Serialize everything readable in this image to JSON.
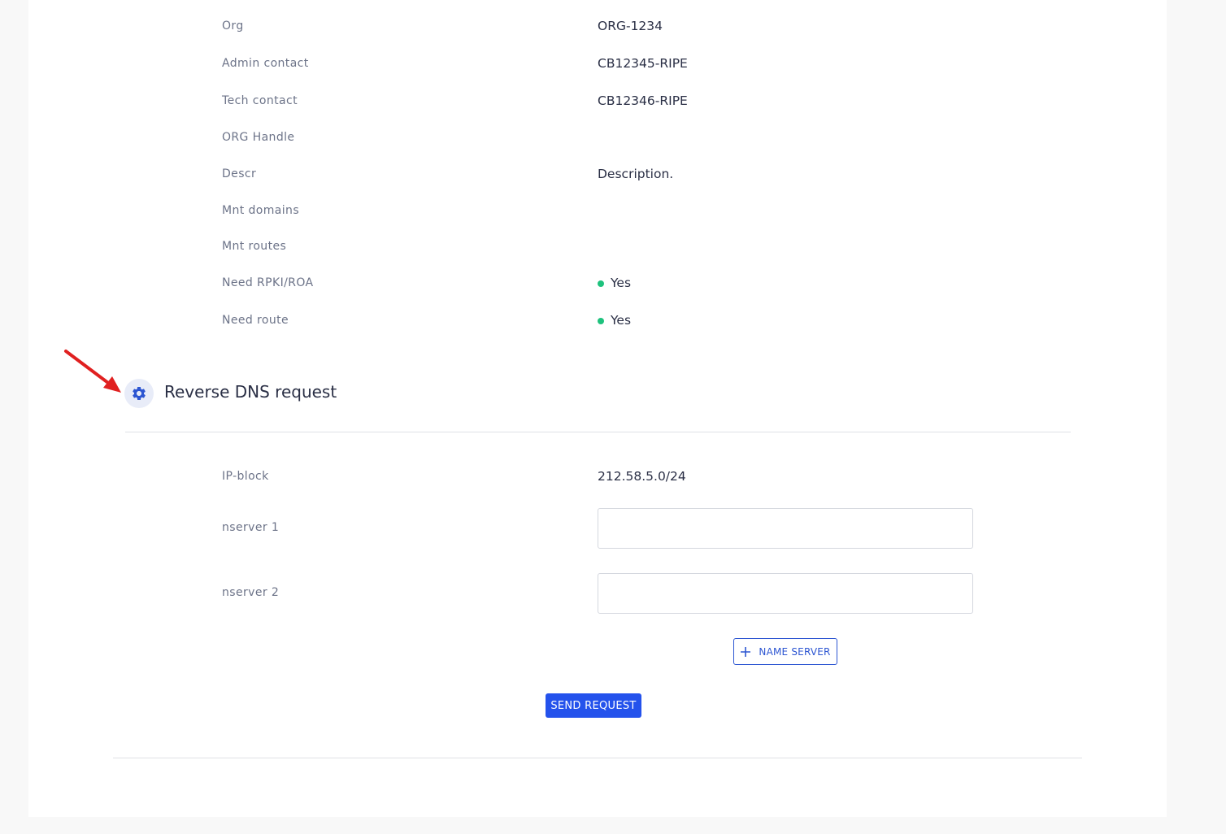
{
  "fields": {
    "org": {
      "label": "Org",
      "value": "ORG-1234"
    },
    "admin_contact": {
      "label": "Admin contact",
      "value": "CB12345-RIPE"
    },
    "tech_contact": {
      "label": "Tech contact",
      "value": "CB12346-RIPE"
    },
    "org_handle": {
      "label": "ORG Handle",
      "value": ""
    },
    "descr": {
      "label": "Descr",
      "value": "Description."
    },
    "mnt_domains": {
      "label": "Mnt domains",
      "value": ""
    },
    "mnt_routes": {
      "label": "Mnt routes",
      "value": ""
    },
    "need_rpki_roa": {
      "label": "Need RPKI/ROA",
      "value": "Yes"
    },
    "need_route": {
      "label": "Need route",
      "value": "Yes"
    }
  },
  "reverse_dns": {
    "title": "Reverse DNS request",
    "icon": "gear-icon",
    "ip_block": {
      "label": "IP-block",
      "value": "212.58.5.0/24"
    },
    "nserver1": {
      "label": "nserver 1",
      "value": "",
      "placeholder": ""
    },
    "nserver2": {
      "label": "nserver 2",
      "value": "",
      "placeholder": ""
    },
    "add_name_server_label": "NAME SERVER",
    "send_request_label": "SEND REQUEST"
  },
  "colors": {
    "accent": "#2452ec",
    "status_green": "#1ec27d",
    "annotation_arrow": "#e02020"
  }
}
